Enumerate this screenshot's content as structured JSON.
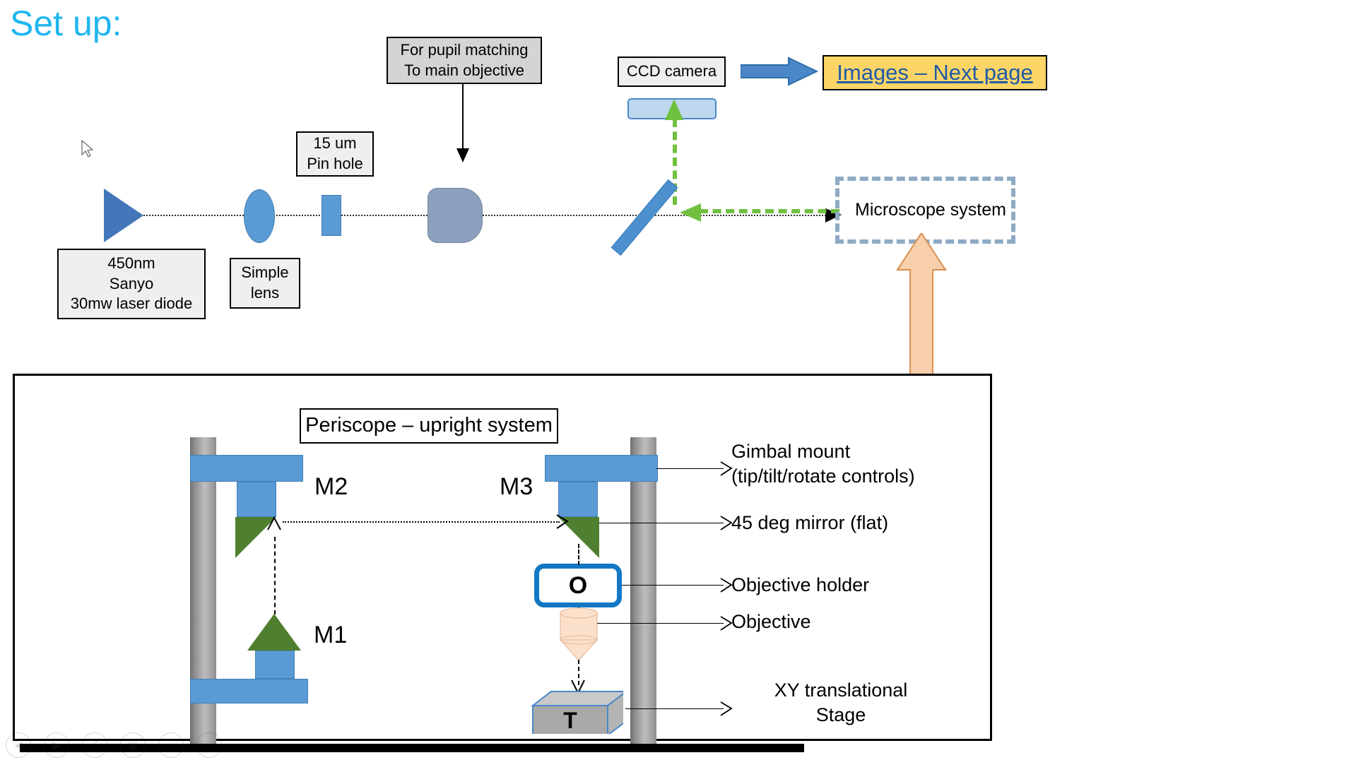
{
  "slide": {
    "title": "Set up:",
    "title_color": "#1FB6F0"
  },
  "optical_path": {
    "laser": {
      "icon": "laser-diode-triangle",
      "label_lines": [
        "450nm",
        "Sanyo",
        "30mw laser diode"
      ]
    },
    "lens": {
      "icon": "simple-lens-ellipse",
      "label_lines": [
        "Simple",
        "lens"
      ]
    },
    "pinhole": {
      "icon": "pin-hole-block",
      "label_lines": [
        "15 um",
        "Pin hole"
      ]
    },
    "main_objective": {
      "icon": "main-objective-barrel",
      "label_lines": [
        "For pupil matching",
        "To main objective"
      ]
    },
    "beam_splitter": {
      "icon": "beam-splitter-diagonal"
    },
    "ccd": {
      "label": "CCD camera",
      "sensor_icon": "ccd-sensor-bar"
    },
    "link": {
      "label": "Images – Next page",
      "color": "#1F5BA8",
      "background": "#FCD566"
    },
    "microscope": {
      "label": "Microscope system",
      "border_color": "#8FAAC4"
    },
    "arrow_to_link": {
      "icon": "right-arrow",
      "color": "#4A86C8"
    },
    "arrow_from_periscope": {
      "icon": "up-arrow",
      "color": "#F6C9A4"
    },
    "beam_color_green": "#70C040"
  },
  "periscope": {
    "title": "Periscope – upright system",
    "mirrors": {
      "m1": "M1",
      "m2": "M2",
      "m3": "M3"
    },
    "objective_holder_letter": "O",
    "stage_letter": "T",
    "annotations": [
      {
        "id": "gimbal",
        "text": "Gimbal mount\n(tip/tilt/rotate controls)"
      },
      {
        "id": "mirror45",
        "text": "45 deg mirror (flat)"
      },
      {
        "id": "objective-holder",
        "text": "Objective holder"
      },
      {
        "id": "objective",
        "text": " Objective"
      },
      {
        "id": "xy-stage",
        "text": "XY translational\nStage"
      }
    ],
    "colors": {
      "mount_blue": "#5B9BD5",
      "mirror_green": "#4F7F2F",
      "post_gray": "#a8a8a8",
      "holder_blue": "#1277C4"
    }
  },
  "toolbar": {
    "items": [
      {
        "name": "previous-slide",
        "glyph": "◀"
      },
      {
        "name": "next-slide",
        "glyph": "▶"
      },
      {
        "name": "pen-tool",
        "glyph": "╱"
      },
      {
        "name": "all-slides",
        "glyph": "▣"
      },
      {
        "name": "zoom-tool",
        "glyph": "○"
      },
      {
        "name": "more-options",
        "glyph": "…"
      }
    ]
  }
}
